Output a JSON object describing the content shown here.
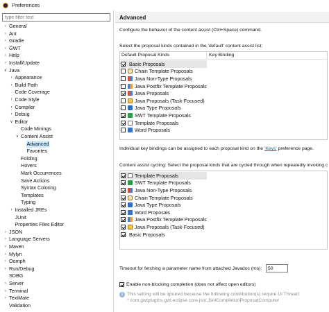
{
  "window": {
    "title": "Preferences"
  },
  "filter": {
    "placeholder": "type filter text"
  },
  "tree": [
    {
      "label": "General",
      "arrow": ">",
      "indent": 0
    },
    {
      "label": "Ant",
      "arrow": ">",
      "indent": 0
    },
    {
      "label": "Gradle",
      "arrow": ">",
      "indent": 0
    },
    {
      "label": "GWT",
      "arrow": ">",
      "indent": 0
    },
    {
      "label": "Help",
      "arrow": ">",
      "indent": 0
    },
    {
      "label": "Install/Update",
      "arrow": ">",
      "indent": 0
    },
    {
      "label": "Java",
      "arrow": "v",
      "indent": 0
    },
    {
      "label": "Appearance",
      "arrow": ">",
      "indent": 1
    },
    {
      "label": "Build Path",
      "arrow": ">",
      "indent": 1
    },
    {
      "label": "Code Coverage",
      "arrow": "",
      "indent": 1
    },
    {
      "label": "Code Style",
      "arrow": ">",
      "indent": 1
    },
    {
      "label": "Compiler",
      "arrow": ">",
      "indent": 1
    },
    {
      "label": "Debug",
      "arrow": ">",
      "indent": 1
    },
    {
      "label": "Editor",
      "arrow": "v",
      "indent": 1
    },
    {
      "label": "Code Minings",
      "arrow": "",
      "indent": 2
    },
    {
      "label": "Content Assist",
      "arrow": "v",
      "indent": 2
    },
    {
      "label": "Advanced",
      "arrow": "",
      "indent": 3,
      "selected": true
    },
    {
      "label": "Favorites",
      "arrow": "",
      "indent": 3
    },
    {
      "label": "Folding",
      "arrow": "",
      "indent": 2
    },
    {
      "label": "Hovers",
      "arrow": "",
      "indent": 2
    },
    {
      "label": "Mark Occurrences",
      "arrow": "",
      "indent": 2
    },
    {
      "label": "Save Actions",
      "arrow": "",
      "indent": 2
    },
    {
      "label": "Syntax Coloring",
      "arrow": "",
      "indent": 2
    },
    {
      "label": "Templates",
      "arrow": "",
      "indent": 2
    },
    {
      "label": "Typing",
      "arrow": "",
      "indent": 2
    },
    {
      "label": "Installed JREs",
      "arrow": ">",
      "indent": 1
    },
    {
      "label": "JUnit",
      "arrow": "",
      "indent": 1
    },
    {
      "label": "Properties Files Editor",
      "arrow": "",
      "indent": 1
    },
    {
      "label": "JSON",
      "arrow": ">",
      "indent": 0
    },
    {
      "label": "Language Servers",
      "arrow": ">",
      "indent": 0
    },
    {
      "label": "Maven",
      "arrow": ">",
      "indent": 0
    },
    {
      "label": "Mylyn",
      "arrow": ">",
      "indent": 0
    },
    {
      "label": "Oomph",
      "arrow": ">",
      "indent": 0
    },
    {
      "label": "Run/Debug",
      "arrow": ">",
      "indent": 0
    },
    {
      "label": "SDBG",
      "arrow": "",
      "indent": 0
    },
    {
      "label": "Server",
      "arrow": ">",
      "indent": 0
    },
    {
      "label": "Terminal",
      "arrow": ">",
      "indent": 0
    },
    {
      "label": "TextMate",
      "arrow": ">",
      "indent": 0
    },
    {
      "label": "Validation",
      "arrow": "",
      "indent": 0
    }
  ],
  "page": {
    "title": "Advanced",
    "description": "Configure the behavior of the content assist (Ctrl+Space) command.",
    "default_list_label": "Select the proposal kinds contained in the 'default' content assist list:",
    "default_list_label_mnemonic": "S",
    "columns": [
      "Default Proposal Kinds",
      "Key Binding"
    ],
    "default_proposals": [
      {
        "label": "Basic Proposals",
        "checked": true,
        "icon": "plain",
        "highlighted": true
      },
      {
        "label": "Chain Template Proposals",
        "checked": false,
        "icon": "chain"
      },
      {
        "label": "Java Non-Type Proposals",
        "checked": false,
        "icon": "java"
      },
      {
        "label": "Java Postfix Template Proposals",
        "checked": false,
        "icon": "javap"
      },
      {
        "label": "Java Proposals",
        "checked": true,
        "icon": "java"
      },
      {
        "label": "Java Proposals (Task-Focused)",
        "checked": false,
        "icon": "jp2"
      },
      {
        "label": "Java Type Proposals",
        "checked": false,
        "icon": "type"
      },
      {
        "label": "SWT Template Proposals",
        "checked": true,
        "icon": "swt"
      },
      {
        "label": "Template Proposals",
        "checked": true,
        "icon": "tmpl"
      },
      {
        "label": "Word Proposals",
        "checked": false,
        "icon": "word"
      }
    ],
    "keybinding_note_prefix": "Individual key bindings can be assigned to each proposal kind on the ",
    "keybinding_link": "'Keys'",
    "keybinding_note_suffix": " preference page.",
    "cycling_label": "Content assist cycling: Select the proposal kinds that are cycled through when repeatedly invoking c",
    "cycling_proposals": [
      {
        "label": "Template Proposals",
        "checked": true,
        "icon": "tmpl",
        "highlighted": true
      },
      {
        "label": "SWT Template Proposals",
        "checked": true,
        "icon": "swt"
      },
      {
        "label": "Java Non-Type Proposals",
        "checked": true,
        "icon": "java"
      },
      {
        "label": "Chain Template Proposals",
        "checked": true,
        "icon": "chain"
      },
      {
        "label": "Java Type Proposals",
        "checked": true,
        "icon": "type"
      },
      {
        "label": "Word Proposals",
        "checked": true,
        "icon": "word"
      },
      {
        "label": "Java Postfix Template Proposals",
        "checked": true,
        "icon": "javap"
      },
      {
        "label": "Java Proposals (Task-Focused)",
        "checked": true,
        "icon": "jp2"
      },
      {
        "label": "Basic Proposals",
        "checked": true,
        "icon": "plain"
      }
    ],
    "timeout_label": "Timeout for fetching a parameter name from attached Javadoc (ms):",
    "timeout_value": "50",
    "nonblocking_label": "Enable non-blocking completion (does not affect open editors)",
    "nonblocking_checked": true,
    "info_line1": "This setting will be ignored because the following contribution(s) require UI Thread:",
    "info_line2": "* com.gwtplugins.gwt.eclipse.core.jsni.JsniCompletionProposalComputer"
  }
}
